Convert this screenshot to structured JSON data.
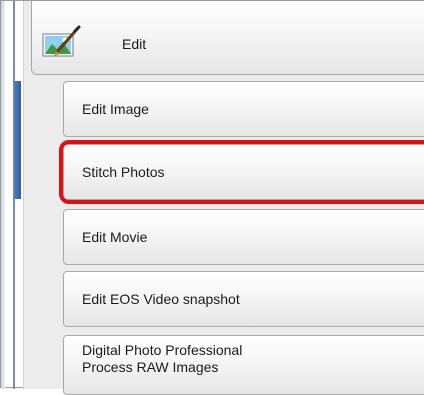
{
  "main_button": {
    "label": "Edit",
    "icon": "edit-picture-icon"
  },
  "menu_items": [
    {
      "label": "Edit Image"
    },
    {
      "label": "Stitch Photos"
    },
    {
      "label": "Edit Movie"
    },
    {
      "label": "Edit EOS Video snapshot"
    },
    {
      "label_line1": "Digital Photo Professional",
      "label_line2": "Process RAW Images"
    }
  ],
  "highlighted_item": "Stitch Photos",
  "colors": {
    "highlight": "#e01010",
    "accent": "#2d5f9e"
  }
}
